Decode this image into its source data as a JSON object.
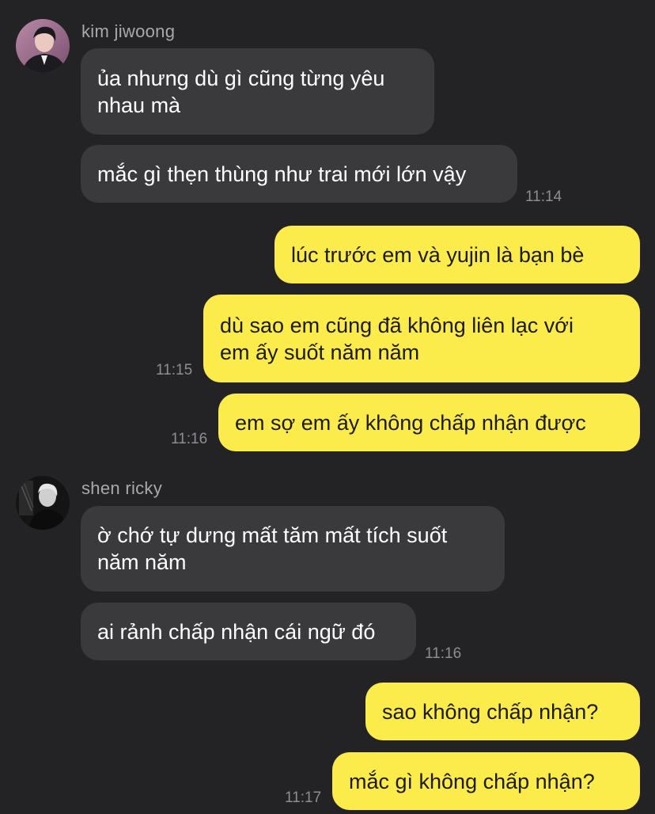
{
  "colors": {
    "background": "#232326",
    "incoming_bubble": "#3a3a3d",
    "outgoing_bubble": "#fbeb4b",
    "sender_name": "#a8a8ad",
    "timestamp": "#8d8d93"
  },
  "messages": [
    {
      "sender": "kim jiwoong",
      "avatar_icon": "kim-jiwoong-avatar",
      "texts": [
        "ủa nhưng dù gì cũng từng yêu\nnhau mà",
        "mắc gì thẹn thùng như trai mới lớn vậy"
      ],
      "time": "11:14"
    },
    {
      "sender": "me",
      "texts": [
        "lúc trước em và yujin là bạn bè",
        "dù sao em cũng đã không liên lạc với\nem ấy suốt năm năm"
      ],
      "time": "11:15"
    },
    {
      "sender": "me",
      "texts": [
        "em sợ em ấy không chấp nhận được"
      ],
      "time": "11:16"
    },
    {
      "sender": "shen ricky",
      "avatar_icon": "shen-ricky-avatar",
      "texts": [
        "ờ chớ tự dưng mất tăm mất tích suốt\nnăm năm",
        "ai rảnh chấp nhận cái ngữ đó"
      ],
      "time": "11:16"
    },
    {
      "sender": "me",
      "texts": [
        "sao không chấp nhận?",
        "mắc gì không chấp nhận?"
      ],
      "time": "11:17"
    }
  ]
}
